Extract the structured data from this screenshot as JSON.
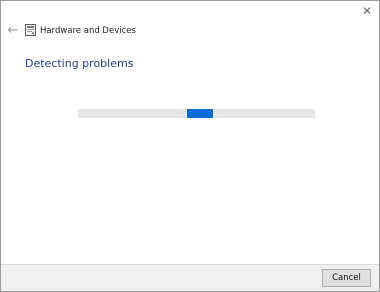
{
  "window": {
    "title": "Hardware and Devices",
    "close_glyph": "✕",
    "back_glyph": "←",
    "app_icon": "hardware-troubleshooter-icon"
  },
  "main": {
    "heading": "Detecting problems",
    "progress": {
      "indeterminate": true,
      "marquee_position": 0.46,
      "marquee_fraction": 0.11,
      "accent_color": "#0b6ad3",
      "track_color": "#e6e6e6"
    }
  },
  "footer": {
    "cancel_label": "Cancel"
  }
}
